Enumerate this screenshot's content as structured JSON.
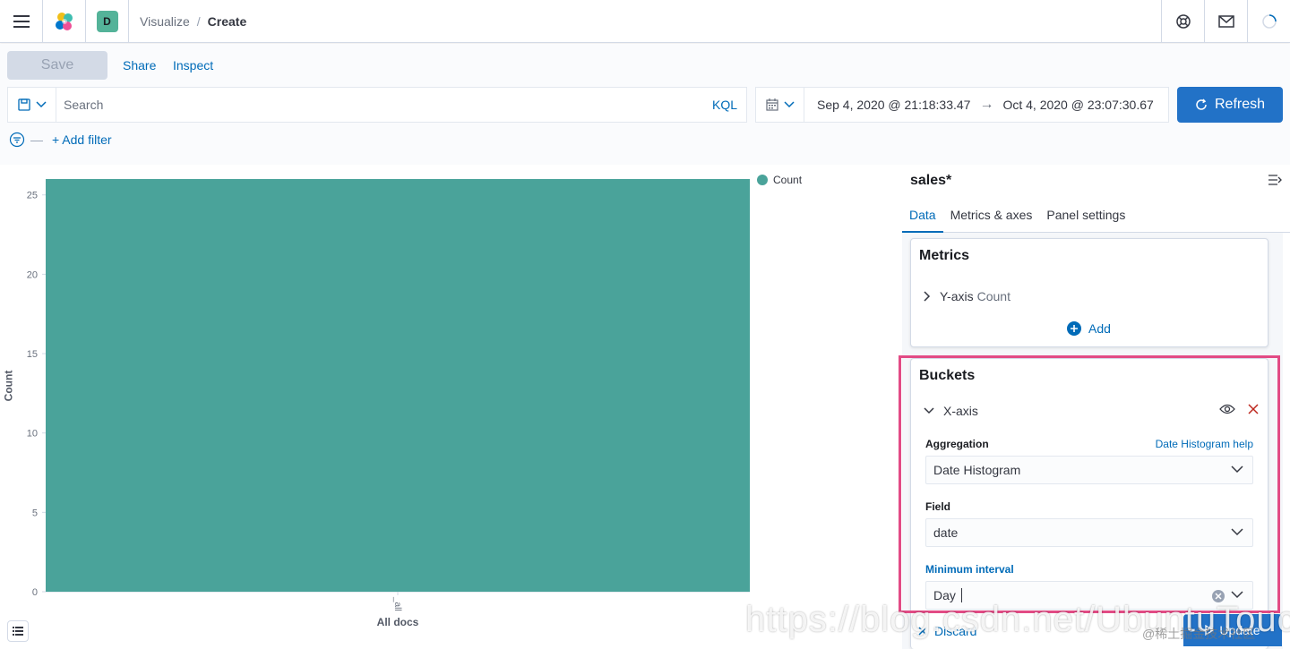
{
  "header": {
    "space_letter": "D",
    "breadcrumbs": [
      "Visualize",
      "Create"
    ]
  },
  "toolbar": {
    "save_label": "Save",
    "share_label": "Share",
    "inspect_label": "Inspect"
  },
  "query": {
    "placeholder": "Search",
    "language": "KQL"
  },
  "time": {
    "start": "Sep 4, 2020 @ 21:18:33.47",
    "arrow": "→",
    "end": "Oct 4, 2020 @ 23:07:30.67",
    "refresh_label": "Refresh"
  },
  "filters": {
    "add_filter_label": "+ Add filter"
  },
  "chart_data": {
    "type": "bar",
    "categories": [
      "_all"
    ],
    "values": [
      26
    ],
    "ylabel": "Count",
    "xlabel": "All docs",
    "yticks": [
      0,
      5,
      10,
      15,
      20,
      25
    ],
    "ylim": [
      0,
      26
    ],
    "grid": false,
    "legend_position": "top-right",
    "legend": [
      "Count"
    ],
    "color": "#4aa39a"
  },
  "sidebar": {
    "index_pattern": "sales*",
    "tabs": [
      {
        "label": "Data",
        "active": true
      },
      {
        "label": "Metrics & axes",
        "active": false
      },
      {
        "label": "Panel settings",
        "active": false
      }
    ],
    "metrics": {
      "title": "Metrics",
      "agg_title": "Y-axis",
      "agg_desc": "Count",
      "add_label": "Add"
    },
    "buckets": {
      "title": "Buckets",
      "agg_title": "X-axis",
      "aggregation_label": "Aggregation",
      "aggregation_help": "Date Histogram help",
      "aggregation_value": "Date Histogram",
      "field_label": "Field",
      "field_value": "date",
      "interval_label": "Minimum interval",
      "interval_value": "Day"
    }
  },
  "footer": {
    "discard_label": "Discard",
    "update_label": "Update"
  },
  "watermark": {
    "main": "https://blog.csdn.net/UbuntuTouch",
    "secondary": "@稀土掘金技术社区"
  },
  "colors": {
    "accent": "#006bb8",
    "primary_button": "#2272c7",
    "highlight": "#e24b85"
  }
}
